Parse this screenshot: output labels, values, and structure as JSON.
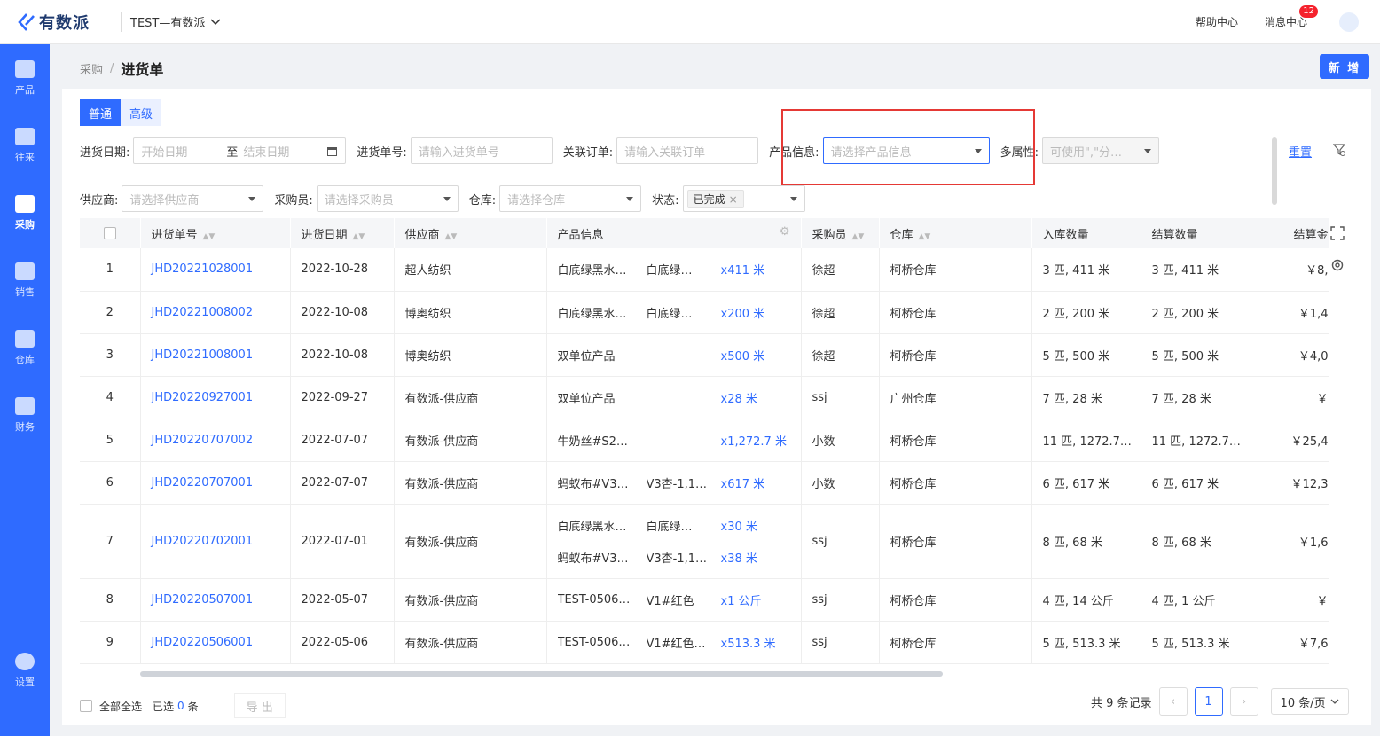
{
  "app": {
    "logo": "有数派",
    "org": "TEST—有数派",
    "help": "帮助中心",
    "messages": "消息中心",
    "message_count": "12"
  },
  "sidebar": {
    "items": [
      {
        "label": "产品",
        "icon": "box-icon"
      },
      {
        "label": "往来",
        "icon": "contact-icon"
      },
      {
        "label": "采购",
        "icon": "cart-icon",
        "active": true
      },
      {
        "label": "销售",
        "icon": "sales-icon"
      },
      {
        "label": "仓库",
        "icon": "warehouse-icon"
      },
      {
        "label": "财务",
        "icon": "finance-icon"
      }
    ],
    "settings": "设置"
  },
  "breadcrumb": {
    "parent": "采购",
    "current": "进货单"
  },
  "new_button": "新 增",
  "tabs": [
    {
      "label": "普通",
      "active": true
    },
    {
      "label": "高级"
    }
  ],
  "filters": {
    "date_label": "进货日期:",
    "date_start": "开始日期",
    "date_to": "至",
    "date_end": "结束日期",
    "order_no_label": "进货单号:",
    "order_no_placeholder": "请输入进货单号",
    "related_label": "关联订单:",
    "related_placeholder": "请输入关联订单",
    "product_label": "产品信息:",
    "product_placeholder": "请选择产品信息",
    "attr_label": "多属性:",
    "attr_placeholder": "可使用\",\"分…",
    "supplier_label": "供应商:",
    "supplier_placeholder": "请选择供应商",
    "buyer_label": "采购员:",
    "buyer_placeholder": "请选择采购员",
    "warehouse_label": "仓库:",
    "warehouse_placeholder": "请选择仓库",
    "status_label": "状态:",
    "status_tag": "已完成",
    "reset": "重置"
  },
  "table": {
    "headers": [
      "进货单号",
      "进货日期",
      "供应商",
      "产品信息",
      "采购员",
      "仓库",
      "入库数量",
      "结算数量",
      "结算金"
    ],
    "rows": [
      {
        "idx": "1",
        "no": "JHD20221028001",
        "date": "2022-10-28",
        "supplier": "超人纺织",
        "products": [
          {
            "name": "白底绿黑水…",
            "variant": "白底绿…",
            "qty": "x411 米"
          }
        ],
        "buyer": "徐超",
        "warehouse": "柯桥仓库",
        "in_qty": "3 匹, 411 米",
        "settle_qty": "3 匹, 411 米",
        "amount": "￥8,"
      },
      {
        "idx": "2",
        "no": "JHD20221008002",
        "date": "2022-10-08",
        "supplier": "博奥纺织",
        "products": [
          {
            "name": "白底绿黑水…",
            "variant": "白底绿…",
            "qty": "x200 米"
          }
        ],
        "buyer": "徐超",
        "warehouse": "柯桥仓库",
        "in_qty": "2 匹, 200 米",
        "settle_qty": "2 匹, 200 米",
        "amount": "￥1,4"
      },
      {
        "idx": "3",
        "no": "JHD20221008001",
        "date": "2022-10-08",
        "supplier": "博奥纺织",
        "products": [
          {
            "name": "双单位产品",
            "variant": "",
            "qty": "x500 米"
          }
        ],
        "buyer": "徐超",
        "warehouse": "柯桥仓库",
        "in_qty": "5 匹, 500 米",
        "settle_qty": "5 匹, 500 米",
        "amount": "￥4,0"
      },
      {
        "idx": "4",
        "no": "JHD20220927001",
        "date": "2022-09-27",
        "supplier": "有数派-供应商",
        "products": [
          {
            "name": "双单位产品",
            "variant": "",
            "qty": "x28 米"
          }
        ],
        "buyer": "ssj",
        "warehouse": "广州仓库",
        "in_qty": "7 匹, 28 米",
        "settle_qty": "7 匹, 28 米",
        "amount": "￥"
      },
      {
        "idx": "5",
        "no": "JHD20220707002",
        "date": "2022-07-07",
        "supplier": "有数派-供应商",
        "products": [
          {
            "name": "牛奶丝#S2…",
            "variant": "",
            "qty": "x1,272.7 米"
          }
        ],
        "buyer": "小数",
        "warehouse": "柯桥仓库",
        "in_qty": "11 匹, 1272.7…",
        "settle_qty": "11 匹, 1272.7…",
        "amount": "￥25,4"
      },
      {
        "idx": "6",
        "no": "JHD20220707001",
        "date": "2022-07-07",
        "supplier": "有数派-供应商",
        "products": [
          {
            "name": "蚂蚁布#V3…",
            "variant": "V3杏-1,1…",
            "qty": "x617 米"
          }
        ],
        "buyer": "小数",
        "warehouse": "柯桥仓库",
        "in_qty": "6 匹, 617 米",
        "settle_qty": "6 匹, 617 米",
        "amount": "￥12,3"
      },
      {
        "idx": "7",
        "no": "JHD20220702001",
        "date": "2022-07-01",
        "supplier": "有数派-供应商",
        "products": [
          {
            "name": "白底绿黑水…",
            "variant": "白底绿…",
            "qty": "x30 米"
          },
          {
            "name": "蚂蚁布#V3…",
            "variant": "V3杏-1,1…",
            "qty": "x38 米"
          }
        ],
        "buyer": "ssj",
        "warehouse": "柯桥仓库",
        "in_qty": "8 匹, 68 米",
        "settle_qty": "8 匹, 68 米",
        "amount": "￥1,6"
      },
      {
        "idx": "8",
        "no": "JHD20220507001",
        "date": "2022-05-07",
        "supplier": "有数派-供应商",
        "products": [
          {
            "name": "TEST-0506…",
            "variant": "V1#红色",
            "qty": "x1 公斤"
          }
        ],
        "buyer": "ssj",
        "warehouse": "柯桥仓库",
        "in_qty": "4 匹, 14 公斤",
        "settle_qty": "4 匹, 1 公斤",
        "amount": "￥"
      },
      {
        "idx": "9",
        "no": "JHD20220506001",
        "date": "2022-05-06",
        "supplier": "有数派-供应商",
        "products": [
          {
            "name": "TEST-0506…",
            "variant": "V1#红色…",
            "qty": "x513.3 米"
          }
        ],
        "buyer": "ssj",
        "warehouse": "柯桥仓库",
        "in_qty": "5 匹, 513.3 米",
        "settle_qty": "5 匹, 513.3 米",
        "amount": "￥7,6"
      }
    ]
  },
  "footer": {
    "select_all": "全部全选",
    "selected_prefix": "已选",
    "selected_count": "0",
    "selected_suffix": "条",
    "export": "导 出",
    "total": "共 9 条记录",
    "page": "1",
    "page_size": "10 条/页"
  }
}
